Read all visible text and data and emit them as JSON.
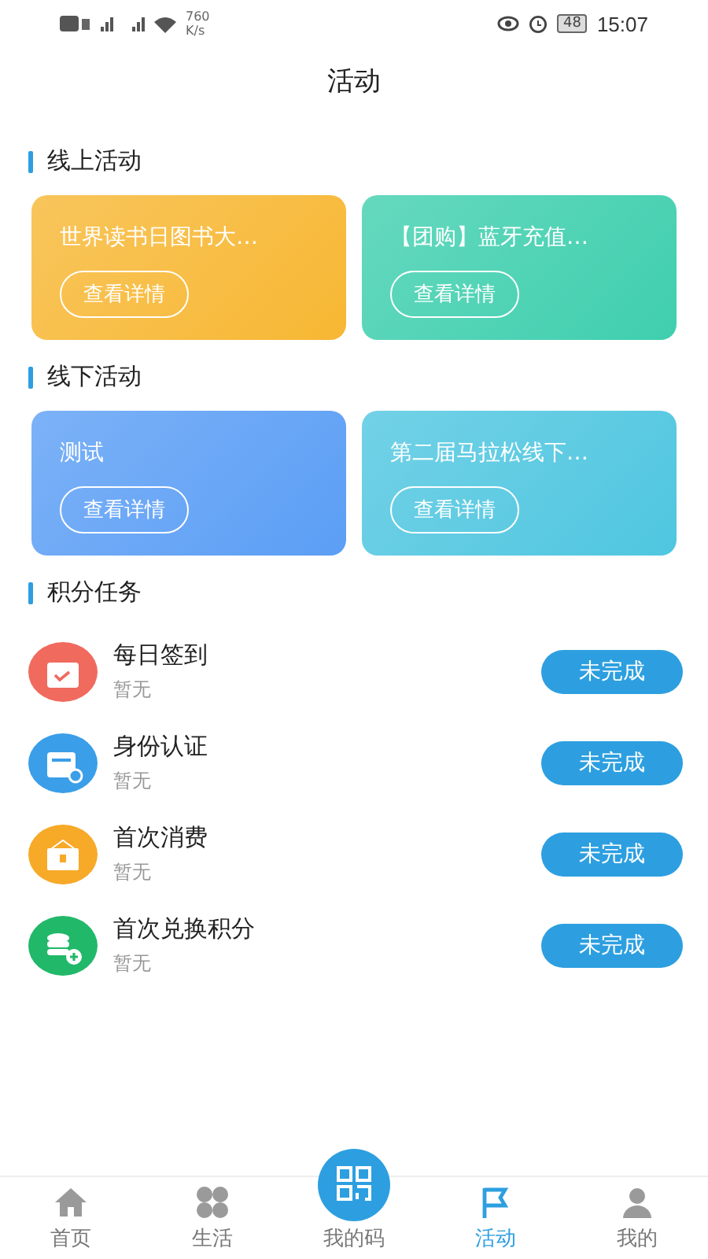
{
  "status_bar": {
    "speed": "760",
    "speed_unit": "K/s",
    "battery": "48",
    "time": "15:07"
  },
  "title": "活动",
  "sections": [
    {
      "kind": "cards",
      "title": "线上活动",
      "cards": [
        {
          "title": "世界读书日图书大…",
          "button": "查看详情",
          "color": "#f7b733"
        },
        {
          "title": "【团购】蓝牙充值…",
          "button": "查看详情",
          "color": "#3fcfae"
        }
      ]
    },
    {
      "kind": "cards",
      "title": "线下活动",
      "cards": [
        {
          "title": "测试",
          "button": "查看详情",
          "color": "#5b9ef5"
        },
        {
          "title": "第二届马拉松线下…",
          "button": "查看详情",
          "color": "#4fc6e0"
        }
      ]
    },
    {
      "kind": "tasks",
      "title": "积分任务",
      "tasks": [
        {
          "name": "每日签到",
          "note": "暂无",
          "button": "未完成",
          "color": "#f06a5e"
        },
        {
          "name": "身份认证",
          "note": "暂无",
          "button": "未完成",
          "color": "#3a9ee8"
        },
        {
          "name": "首次消费",
          "note": "暂无",
          "button": "未完成",
          "color": "#f7a928"
        },
        {
          "name": "首次兑换积分",
          "note": "暂无",
          "button": "未完成",
          "color": "#22b86a"
        }
      ]
    }
  ],
  "tab_bar": [
    {
      "label": "首页",
      "selected": false
    },
    {
      "label": "生活",
      "selected": false
    },
    {
      "label": "我的码",
      "selected": false
    },
    {
      "label": "活动",
      "selected": true
    },
    {
      "label": "我的",
      "selected": false
    }
  ]
}
